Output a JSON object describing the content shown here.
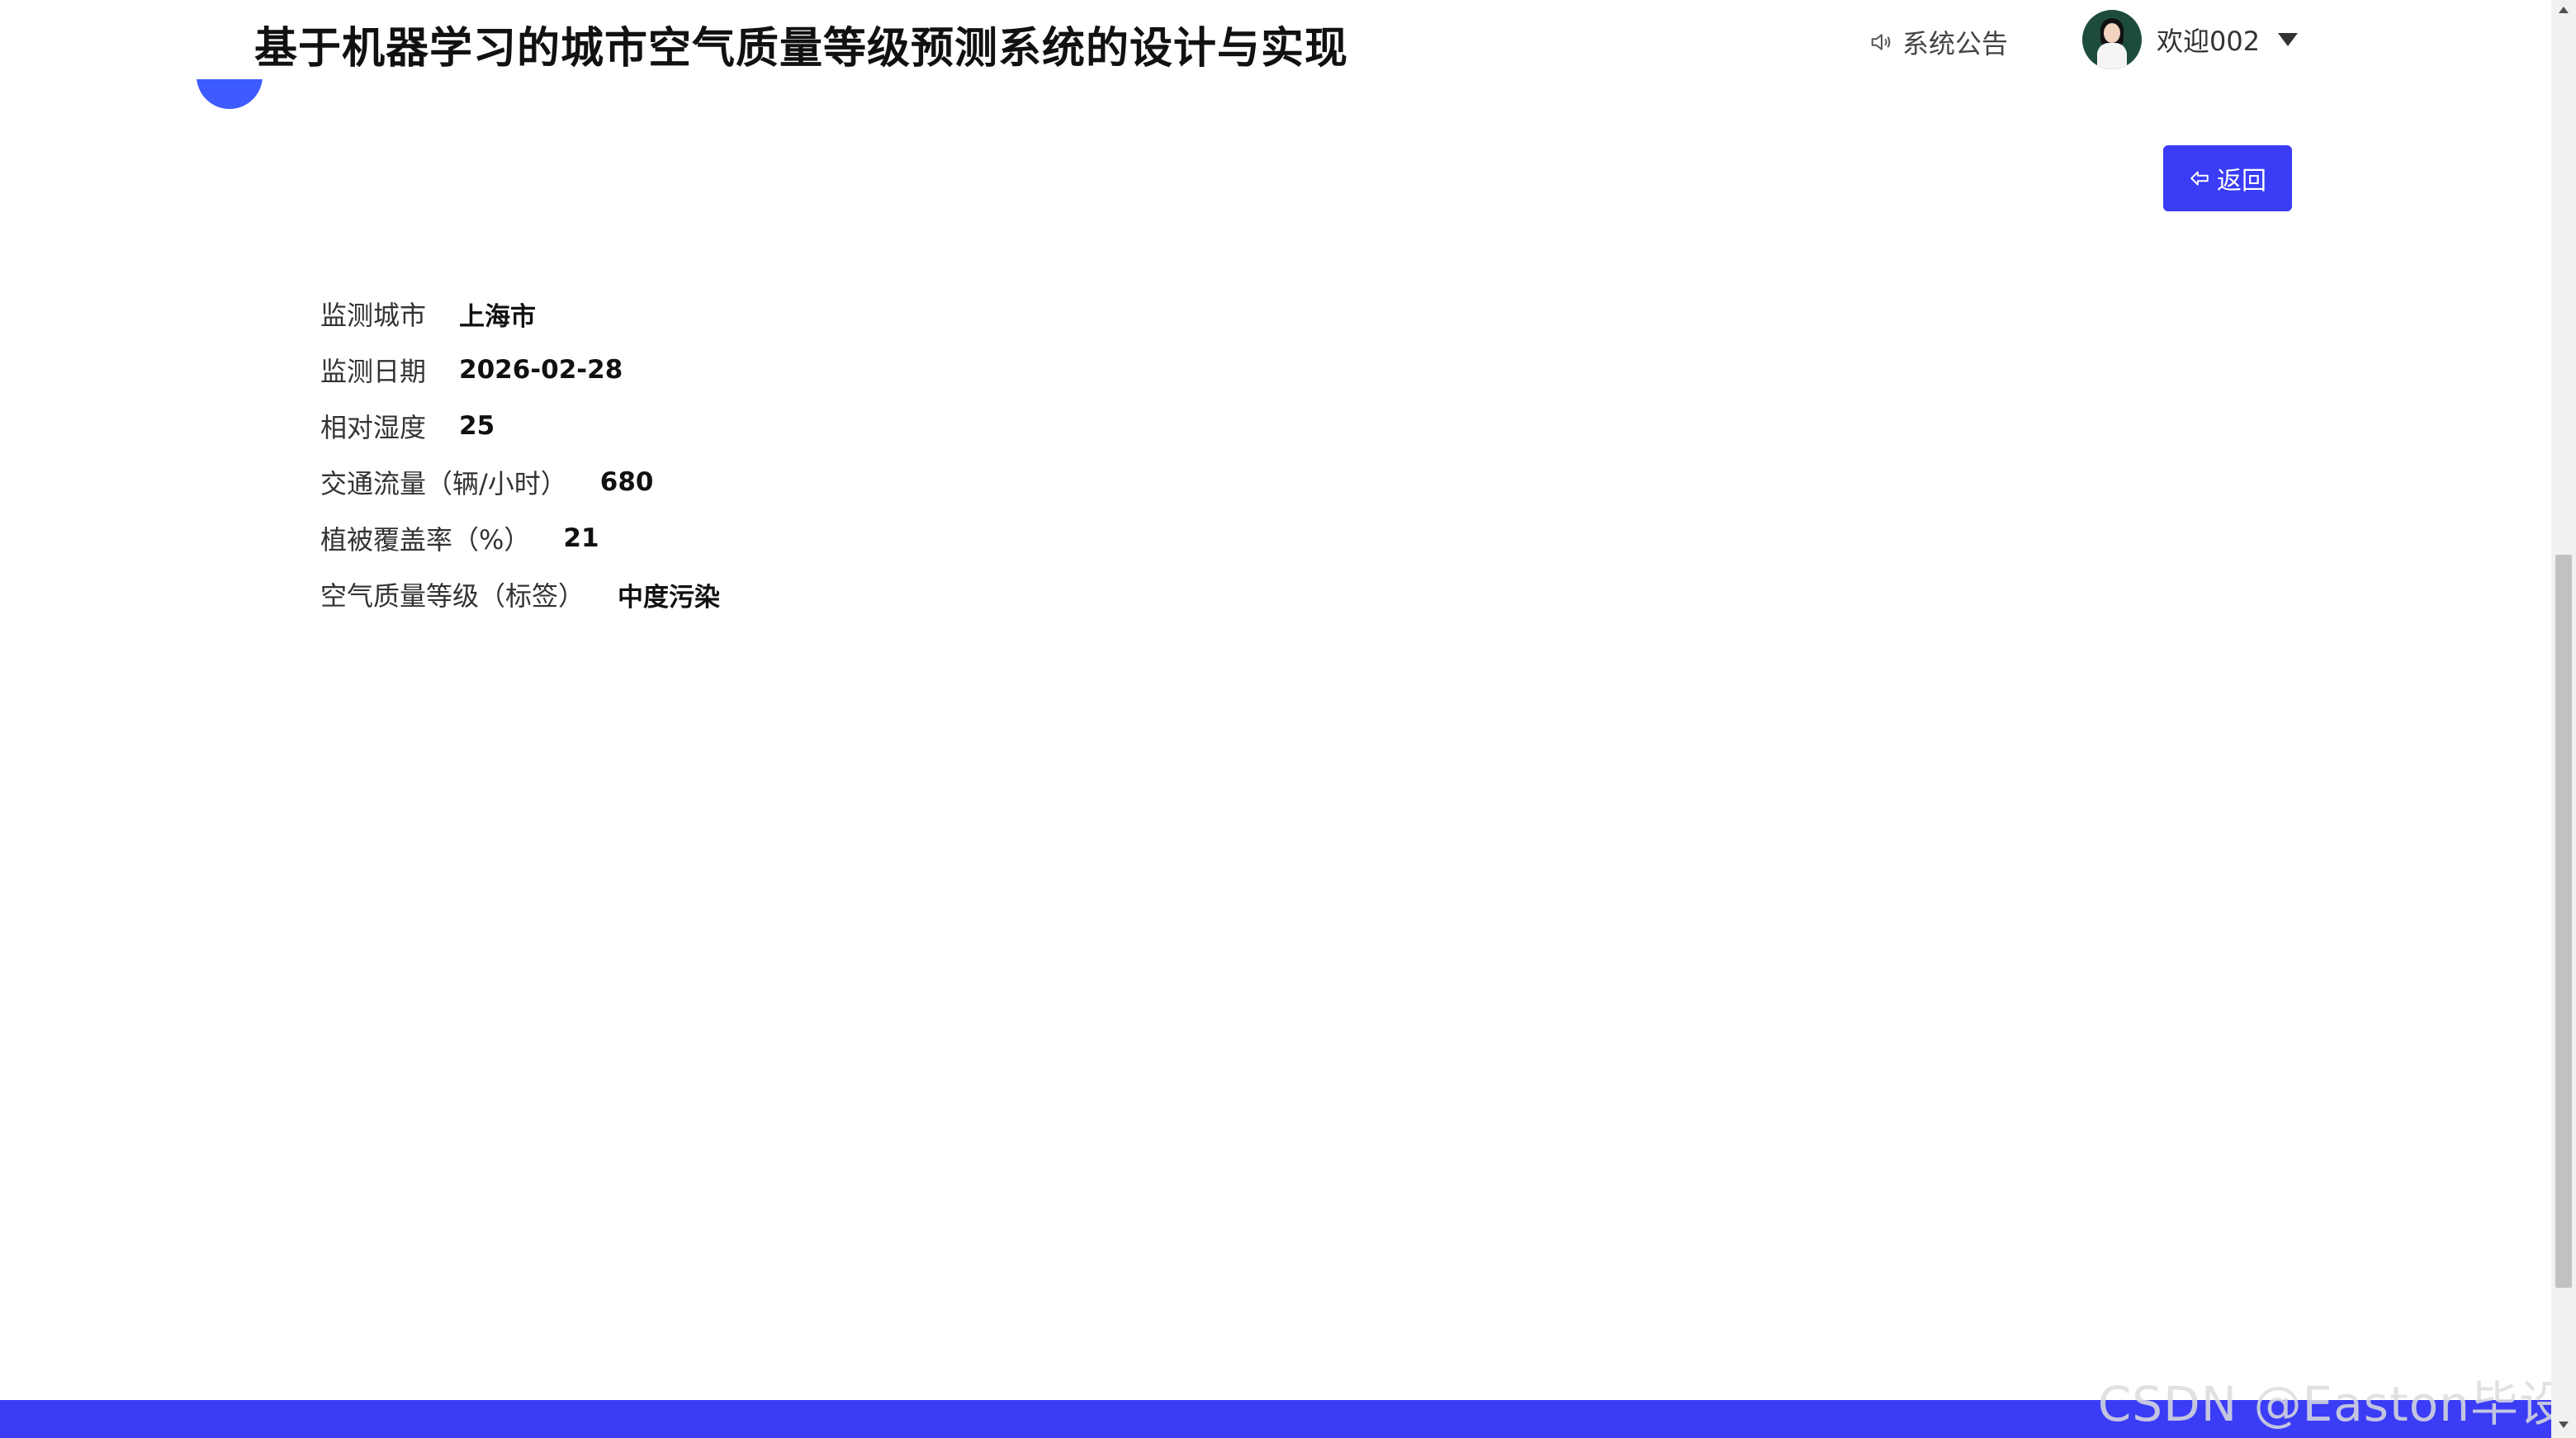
{
  "header": {
    "title": "基于机器学习的城市空气质量等级预测系统的设计与实现",
    "notice_label": "系统公告",
    "notice_icon": "speaker-icon",
    "welcome_text": "欢迎002"
  },
  "toolbar": {
    "back_label": "返回",
    "back_icon": "back-arrow-icon"
  },
  "details": [
    {
      "label": "监测城市",
      "value": "上海市"
    },
    {
      "label": "监测日期",
      "value": "2026-02-28"
    },
    {
      "label": "相对湿度",
      "value": "25"
    },
    {
      "label": "交通流量（辆/小时）",
      "value": "680"
    },
    {
      "label": "植被覆盖率（%）",
      "value": "21"
    },
    {
      "label": "空气质量等级（标签）",
      "value": "中度污染"
    }
  ],
  "watermark": "CSDN @Easton毕设",
  "colors": {
    "primary": "#3a3cf6",
    "title": "#111111"
  }
}
